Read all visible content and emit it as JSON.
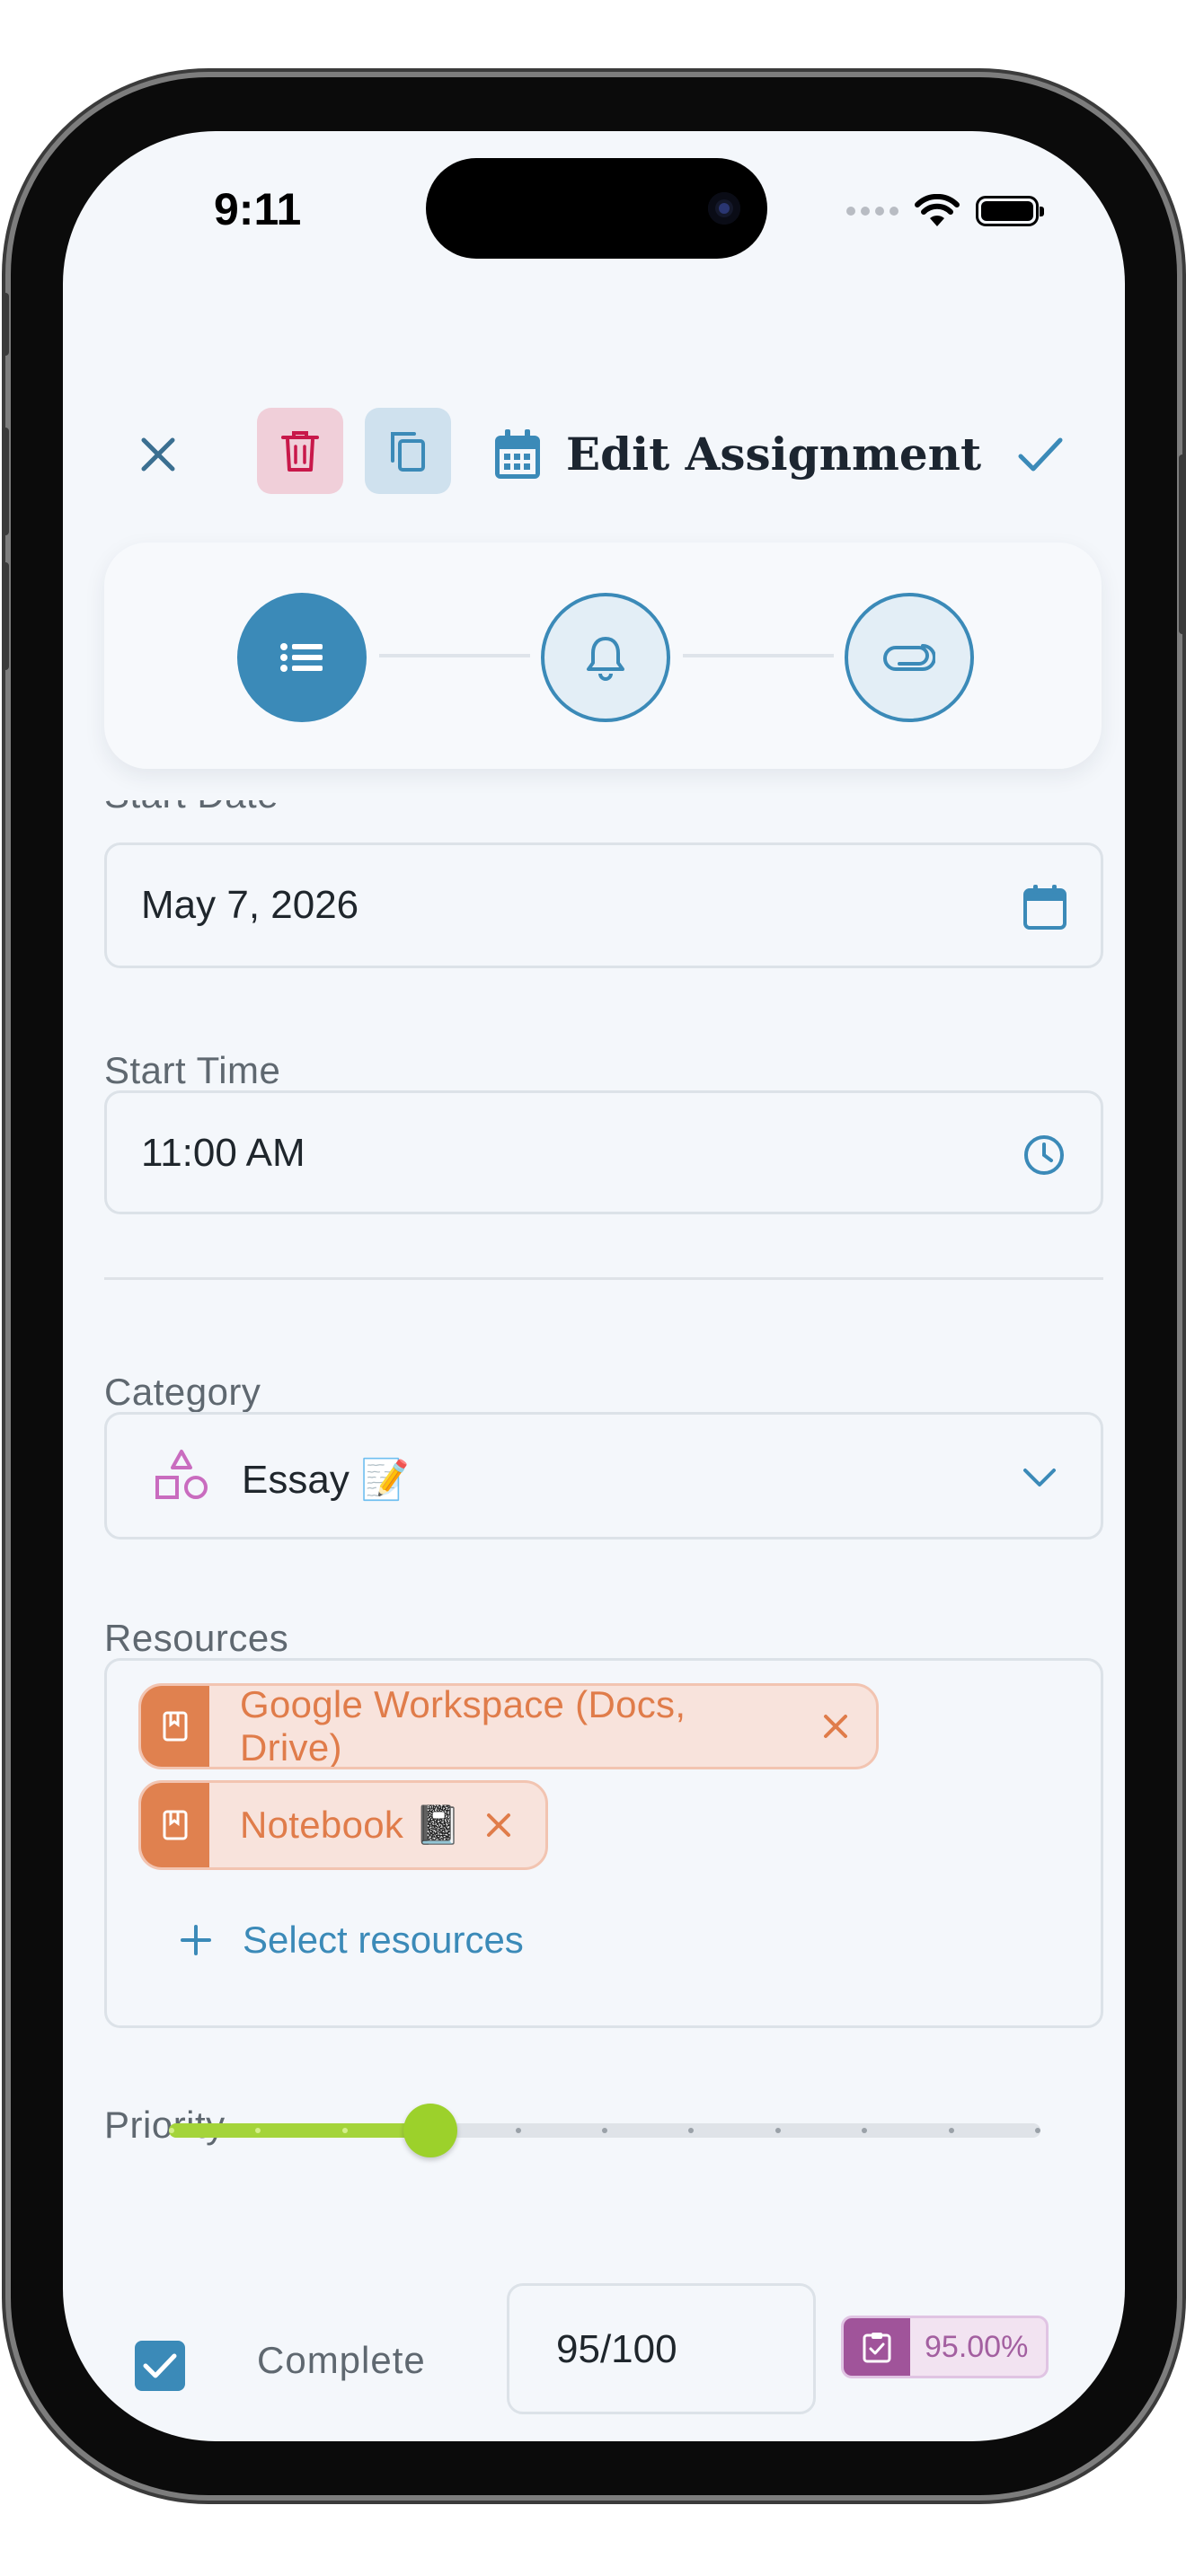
{
  "status_bar": {
    "time": "9:11"
  },
  "header": {
    "title": "Edit Assignment"
  },
  "form": {
    "start_date_label": "Start Date",
    "start_date_value": "May 7, 2026",
    "start_time_label": "Start Time",
    "start_time_value": "11:00 AM",
    "category_label": "Category",
    "category_value": "Essay 📝",
    "resources_label": "Resources",
    "resources": [
      {
        "label": "Google Workspace (Docs, Drive)"
      },
      {
        "label": "Notebook 📓"
      }
    ],
    "select_resources_label": "Select resources",
    "priority_label": "Priority",
    "priority_value_fraction": 0.3,
    "complete_label": "Complete",
    "complete_checked": true,
    "score_value": "95/100",
    "score_percent": "95.00%"
  },
  "colors": {
    "accent": "#3b8ab8",
    "delete": "#c8184a",
    "resource": "#e07c4a",
    "priority": "#a4d43a",
    "score": "#a0549a"
  }
}
